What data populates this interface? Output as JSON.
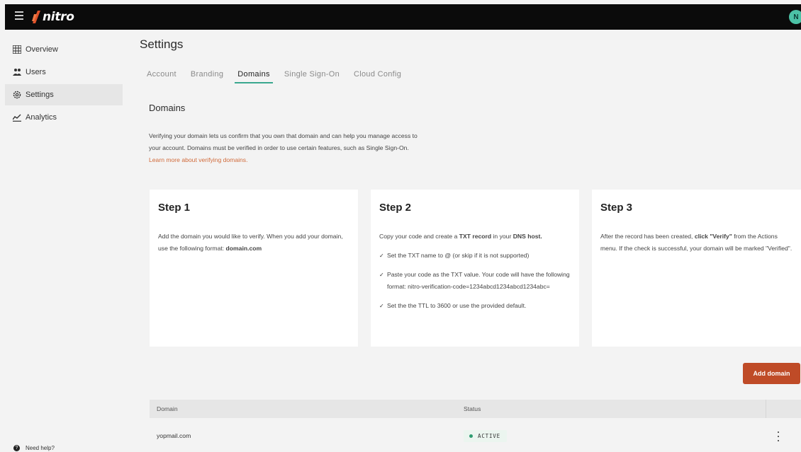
{
  "app": {
    "brand": "nitro",
    "avatar_initial": "N",
    "accent": "#3aa78f",
    "brand_color": "#bf4b27"
  },
  "sidebar": {
    "items": [
      {
        "label": "Overview",
        "icon": "grid-icon"
      },
      {
        "label": "Users",
        "icon": "users-icon"
      },
      {
        "label": "Settings",
        "icon": "gear-icon",
        "active": true
      },
      {
        "label": "Analytics",
        "icon": "chart-icon"
      }
    ],
    "help_label": "Need help?"
  },
  "page": {
    "title": "Settings"
  },
  "tabs": [
    "Account",
    "Branding",
    "Domains",
    "Single Sign-On",
    "Cloud Config"
  ],
  "active_tab": "Domains",
  "domains": {
    "title": "Domains",
    "intro": "Verifying your domain lets us confirm that you own that domain and can help you manage access to your account. Domains must be verified in order to use certain features, such as Single Sign-On.",
    "intro_link": "Learn more about verifying domains.",
    "steps": [
      {
        "title": "Step 1",
        "text_before": "Add the domain you would like to verify. When you add your domain, use the following format: ",
        "text_bold": "domain.com"
      },
      {
        "title": "Step 2",
        "text_a": "Copy your code and create a ",
        "bold_a": "TXT record",
        "text_b": " in your ",
        "bold_b": "DNS host.",
        "bullets": [
          "Set the TXT name to @ (or skip if it is not supported)",
          "Paste your code as the TXT value. Your code will have the following format: nitro-verification-code=1234abcd1234abcd1234abc=",
          "Set the the TTL to 3600 or use the provided default."
        ]
      },
      {
        "title": "Step 3",
        "text_a": "After the record has been created, ",
        "bold_a": "click \"Verify\"",
        "text_b": " from the Actions menu. If the check is successful, your domain will be marked \"Verified\"."
      }
    ],
    "add_button": "Add domain",
    "table": {
      "headers": [
        "Domain",
        "Status"
      ],
      "rows": [
        {
          "domain": "yopmail.com",
          "status": "ACTIVE"
        }
      ]
    }
  }
}
